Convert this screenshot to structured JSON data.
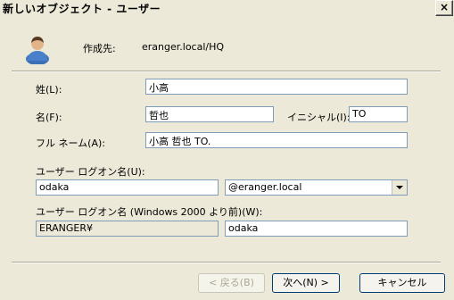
{
  "window": {
    "title": "新しいオブジェクト - ユーザー",
    "close_glyph": "×"
  },
  "header": {
    "created_in_label": "作成先:",
    "created_in_value": "eranger.local/HQ"
  },
  "form": {
    "last_name_label": "姓(L):",
    "last_name_value": "小高",
    "first_name_label": "名(F):",
    "first_name_value": "哲也",
    "initials_label": "イニシャル(I):",
    "initials_value": "TO",
    "full_name_label": "フル ネーム(A):",
    "full_name_value": "小高 哲也 TO.",
    "logon_name_label": "ユーザー ログオン名(U):",
    "logon_name_value": "odaka",
    "domain_value": "@eranger.local",
    "pre2000_label": "ユーザー ログオン名 (Windows 2000 より前)(W):",
    "pre2000_domain_value": "ERANGER¥",
    "pre2000_name_value": "odaka"
  },
  "buttons": {
    "back": "< 戻る(B)",
    "next": "次へ(N) >",
    "cancel": "キャンセル"
  }
}
